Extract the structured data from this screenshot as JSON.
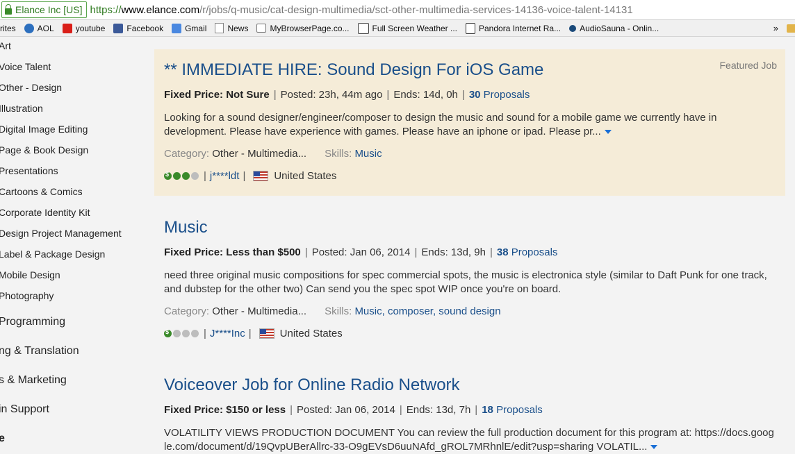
{
  "address_bar": {
    "security_label": "Elance Inc [US]",
    "url_scheme": "https://",
    "url_host": "www.elance.com",
    "url_path": "/r/jobs/q-music/cat-design-multimedia/sct-other-multimedia-services-14136-voice-talent-14131"
  },
  "bookmarks": {
    "items": [
      {
        "label": "rites",
        "icon": "none"
      },
      {
        "label": "AOL",
        "icon": "aol-icon"
      },
      {
        "label": "youtube",
        "icon": "youtube-icon"
      },
      {
        "label": "Facebook",
        "icon": "facebook-icon"
      },
      {
        "label": "Gmail",
        "icon": "google-icon"
      },
      {
        "label": "News",
        "icon": "page-icon"
      },
      {
        "label": "MyBrowserPage.co...",
        "icon": "home-icon"
      },
      {
        "label": "Full Screen Weather ...",
        "icon": "weather-icon"
      },
      {
        "label": "Pandora Internet Ra...",
        "icon": "pandora-icon"
      },
      {
        "label": "AudioSauna - Onlin...",
        "icon": "audiosauna-icon"
      }
    ],
    "overflow": "»"
  },
  "sidebar": {
    "items": [
      "Art",
      "Voice Talent",
      "Other - Design",
      "Illustration",
      "Digital Image Editing",
      "Page & Book Design",
      "Presentations",
      "Cartoons & Comics",
      "Corporate Identity Kit",
      "Design Project Management",
      "Label & Package Design",
      "Mobile Design",
      "Photography"
    ],
    "sections": [
      "Programming",
      "ng & Translation",
      "s & Marketing",
      "in Support",
      "e"
    ]
  },
  "jobs": [
    {
      "title": "** IMMEDIATE HIRE: Sound Design For iOS Game",
      "badge": "Featured Job",
      "price_label": "Fixed Price:",
      "price_value": "Not Sure",
      "posted": "Posted: 23h, 44m ago",
      "ends": "Ends: 14d, 0h",
      "proposals_count": "30",
      "proposals_label": "Proposals",
      "description": "Looking for a sound designer/engineer/composer to design the music and sound for a mobile game we currently have in development. Please have experience with games. Please have an iphone or ipad. Please pr...",
      "category_label": "Category:",
      "category_value": "Other - Multimedia...",
      "skills_label": "Skills:",
      "skills_value": "Music",
      "client_user": "j****ldt",
      "client_country": "United States",
      "rating_filled": 3
    },
    {
      "title": "Music",
      "price_label": "Fixed Price:",
      "price_value": "Less than $500",
      "posted": "Posted: Jan 06, 2014",
      "ends": "Ends: 13d, 9h",
      "proposals_count": "38",
      "proposals_label": "Proposals",
      "description": "need three original music compositions for spec commercial spots, the music is electronica style (similar to Daft Punk for one track, and dubstep for the other two) Can send you the spec spot WIP once you're on board.",
      "category_label": "Category:",
      "category_value": "Other - Multimedia...",
      "skills_label": "Skills:",
      "skills_value": "Music, composer, sound design",
      "client_user": "J****Inc",
      "client_country": "United States",
      "rating_filled": 1
    },
    {
      "title": "Voiceover Job for Online Radio Network",
      "price_label": "Fixed Price:",
      "price_value": "$150 or less",
      "posted": "Posted: Jan 06, 2014",
      "ends": "Ends: 13d, 7h",
      "proposals_count": "18",
      "proposals_label": "Proposals",
      "description": "VOLATILITY VIEWS PRODUCTION DOCUMENT You can review the full production document for this program at: https://docs.google.com/document/d/19QvpUBerAllrc-33-O9gEVsD6uuNAfd_gROL7MRhnlE/edit?usp=sharing VOLATIL..."
    }
  ]
}
